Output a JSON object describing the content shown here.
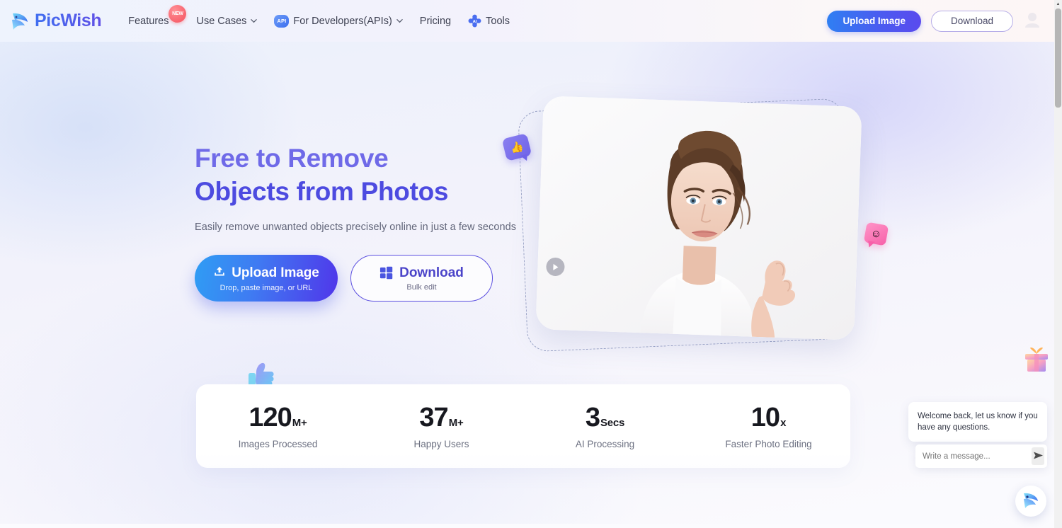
{
  "nav": {
    "logo_text": "PicWish",
    "logo_icon": "picwish-bird-logo",
    "items": [
      {
        "label": "Features",
        "has_caret": true,
        "badge": "NEW",
        "icon": null
      },
      {
        "label": "Use Cases",
        "has_caret": true,
        "badge": null,
        "icon": null
      },
      {
        "label": "For Developers(APIs)",
        "has_caret": true,
        "badge": null,
        "icon": "api-chip-icon",
        "icon_text": "API"
      },
      {
        "label": "Pricing",
        "has_caret": false,
        "badge": null,
        "icon": null
      },
      {
        "label": "Tools",
        "has_caret": false,
        "badge": null,
        "icon": "ai-chip-icon",
        "icon_text": "AI"
      }
    ],
    "upload_label": "Upload Image",
    "download_label": "Download",
    "avatar_icon": "user-avatar-icon"
  },
  "hero": {
    "headline_line1": "Free to Remove",
    "headline_line2": "Objects from Photos",
    "subhead": "Easily remove unwanted objects precisely online in just a few seconds",
    "upload_button": {
      "title": "Upload Image",
      "subtitle": "Drop, paste image, or URL",
      "icon": "upload-icon"
    },
    "download_button": {
      "title": "Download",
      "subtitle": "Bulk edit",
      "icon": "windows-icon"
    },
    "image_alt": "portrait-photo-woman",
    "stickers": [
      {
        "name": "thumbs-up-sticker",
        "glyph": "👍"
      },
      {
        "name": "smiley-sticker",
        "glyph": "☺"
      }
    ]
  },
  "stats": [
    {
      "number": "120",
      "unit": "M+",
      "label": "Images Processed"
    },
    {
      "number": "37",
      "unit": "M+",
      "label": "Happy Users"
    },
    {
      "number": "3",
      "unit": "Secs",
      "label": "AI Processing"
    },
    {
      "number": "10",
      "unit": "x",
      "label": "Faster Photo Editing"
    }
  ],
  "chat": {
    "welcome_message": "Welcome back, let us know if you have any questions.",
    "input_placeholder": "Write a message...",
    "input_value": "",
    "send_icon": "send-arrow-icon",
    "launcher_icon": "picwish-bird-logo"
  },
  "decorations": {
    "gift_icon": "gift-box-icon",
    "thumb_icon": "thumbs-up-decoration",
    "play_icon": "play-arrow-icon"
  },
  "colors": {
    "brand_blue": "#3f6ef0",
    "brand_purple": "#5a4aee",
    "headline_light": "#6f6ae8",
    "headline_dark": "#4d4be0",
    "badge_red": "#f8636e"
  }
}
